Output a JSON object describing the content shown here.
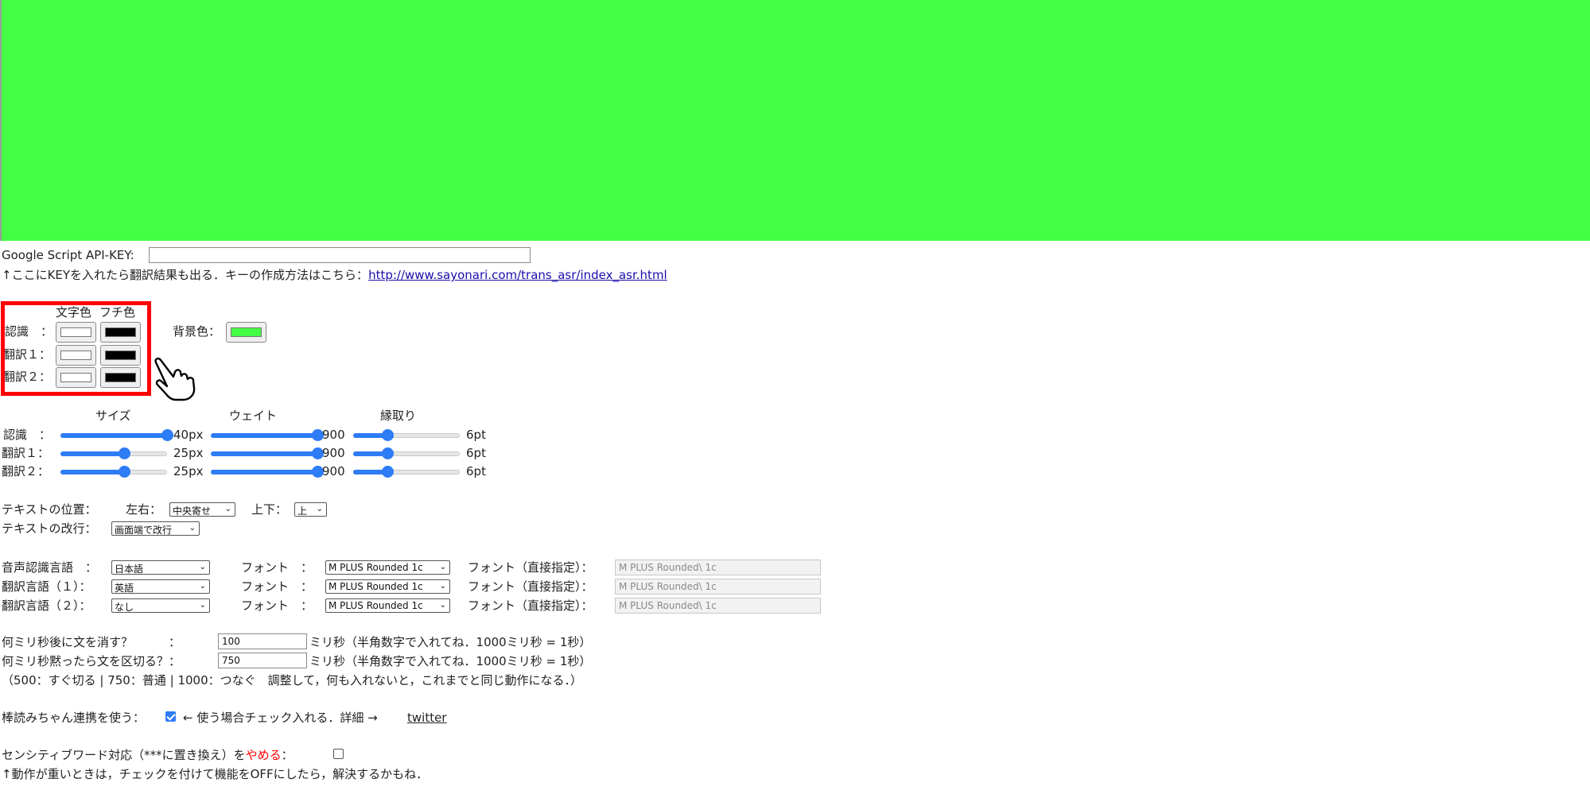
{
  "preview": {
    "background_color": "#44ff44"
  },
  "api": {
    "label": "Google Script API-KEY:",
    "value": "",
    "note_prefix": "↑ここにKEYを入れたら翻訳結果も出る．キーの作成方法はこちら：",
    "note_link": "http://www.sayonari.com/trans_asr/index_asr.html"
  },
  "colors": {
    "header_text": "文字色",
    "header_outline": "フチ色",
    "rows": [
      {
        "label": "認識　：",
        "text_color": "#ffffff",
        "outline_color": "#000000"
      },
      {
        "label": "翻訳１：",
        "text_color": "#ffffff",
        "outline_color": "#000000"
      },
      {
        "label": "翻訳２：",
        "text_color": "#ffffff",
        "outline_color": "#000000"
      }
    ],
    "bg_label": "背景色：",
    "bg_color": "#44ff44"
  },
  "sliders": {
    "header_size": "サイズ",
    "header_weight": "ウェイト",
    "header_outline": "縁取り",
    "rows": [
      {
        "label": "認識　：",
        "size": 1.0,
        "size_text": "40px",
        "weight": 1.0,
        "weight_text": "900",
        "outline": 0.32,
        "outline_text": "6pt"
      },
      {
        "label": "翻訳１：",
        "size": 0.6,
        "size_text": "25px",
        "weight": 1.0,
        "weight_text": "900",
        "outline": 0.32,
        "outline_text": "6pt"
      },
      {
        "label": "翻訳２：",
        "size": 0.6,
        "size_text": "25px",
        "weight": 1.0,
        "weight_text": "900",
        "outline": 0.32,
        "outline_text": "6pt"
      }
    ]
  },
  "position": {
    "label": "テキストの位置：",
    "horizontal_label": "左右：",
    "horizontal_value": "中央寄せ",
    "vertical_label": "上下：",
    "vertical_value": "上",
    "wrap_label": "テキストの改行：",
    "wrap_value": "画面端で改行"
  },
  "languages": {
    "rows": [
      {
        "label": "音声認識言語　：",
        "lang": "日本語",
        "font_label": "フォント　：",
        "font": "M PLUS Rounded 1c",
        "direct_label": "フォント（直接指定）：",
        "direct_value": "M PLUS Rounded\\ 1c"
      },
      {
        "label": "翻訳言語（１）：",
        "lang": "英語",
        "font_label": "フォント　：",
        "font": "M PLUS Rounded 1c",
        "direct_label": "フォント（直接指定）：",
        "direct_value": "M PLUS Rounded\\ 1c"
      },
      {
        "label": "翻訳言語（２）：",
        "lang": "なし",
        "font_label": "フォント　：",
        "font": "M PLUS Rounded 1c",
        "direct_label": "フォント（直接指定）：",
        "direct_value": "M PLUS Rounded\\ 1c"
      }
    ]
  },
  "timing": {
    "erase_label": "何ミリ秒後に文を消す？　　　：",
    "erase_value": "100",
    "erase_note": "ミリ秒（半角数字で入れてね．1000ミリ秒 = 1秒）",
    "split_label": "何ミリ秒黙ったら文を区切る？：",
    "split_value": "750",
    "split_note": "ミリ秒（半角数字で入れてね．1000ミリ秒 = 1秒）",
    "hint": "（500：すぐ切る | 750：普通 | 1000：つなぐ　調整して，何も入れないと，これまでと同じ動作になる．）"
  },
  "bouyomi": {
    "label": "棒読みちゃん連携を使う：",
    "checked": true,
    "note": "← 使う場合チェック入れる．詳細 →",
    "link": "twitter"
  },
  "sensitive": {
    "label_prefix": "センシティブワード対応（***に置き換え）を",
    "label_red": "やめる",
    "label_suffix": "：",
    "checked": false,
    "note": "↑動作が重いときは，チェックを付けて機能をOFFにしたら，解決するかもね．"
  }
}
